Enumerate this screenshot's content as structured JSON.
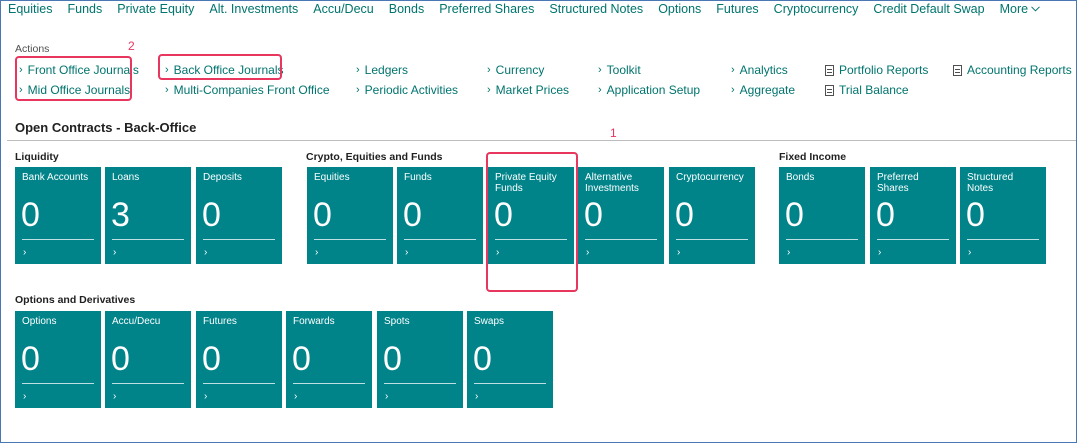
{
  "topnav": {
    "items": [
      "Equities",
      "Funds",
      "Private Equity",
      "Alt. Investments",
      "Accu/Decu",
      "Bonds",
      "Preferred Shares",
      "Structured Notes",
      "Options",
      "Futures",
      "Cryptocurrency",
      "Credit Default Swap"
    ],
    "more": "More"
  },
  "actions": {
    "label": "Actions",
    "front_office_journals": "Front Office Journals",
    "mid_office_journals": "Mid Office Journals",
    "back_office_journals": "Back Office Journals",
    "multi_companies_front_office": "Multi-Companies Front Office",
    "ledgers": "Ledgers",
    "periodic_activities": "Periodic Activities",
    "currency": "Currency",
    "market_prices": "Market Prices",
    "toolkit": "Toolkit",
    "application_setup": "Application Setup",
    "analytics": "Analytics",
    "aggregate": "Aggregate",
    "portfolio_reports": "Portfolio Reports",
    "trial_balance": "Trial Balance",
    "accounting_reports": "Accounting Reports"
  },
  "annotations": {
    "marker_1": "1",
    "marker_2": "2",
    "highlight_color": "#e8365f"
  },
  "page": {
    "title": "Open Contracts - Back-Office"
  },
  "groups": {
    "liquidity": {
      "title": "Liquidity",
      "tiles": [
        {
          "title": "Bank Accounts",
          "value": "0"
        },
        {
          "title": "Loans",
          "value": "3"
        },
        {
          "title": "Deposits",
          "value": "0"
        }
      ]
    },
    "crypto": {
      "title": "Crypto, Equities and Funds",
      "tiles": [
        {
          "title": "Equities",
          "value": "0"
        },
        {
          "title": "Funds",
          "value": "0"
        },
        {
          "title": "Private Equity Funds",
          "value": "0"
        },
        {
          "title": "Alternative Investments",
          "value": "0"
        },
        {
          "title": "Cryptocurrency",
          "value": "0"
        }
      ]
    },
    "fixed_income": {
      "title": "Fixed Income",
      "tiles": [
        {
          "title": "Bonds",
          "value": "0"
        },
        {
          "title": "Preferred Shares",
          "value": "0"
        },
        {
          "title": "Structured Notes",
          "value": "0"
        }
      ]
    },
    "options": {
      "title": "Options and Derivatives",
      "tiles": [
        {
          "title": "Options",
          "value": "0"
        },
        {
          "title": "Accu/Decu",
          "value": "0"
        },
        {
          "title": "Futures",
          "value": "0"
        },
        {
          "title": "Forwards",
          "value": "0"
        },
        {
          "title": "Spots",
          "value": "0"
        },
        {
          "title": "Swaps",
          "value": "0"
        }
      ]
    }
  },
  "colors": {
    "tile_bg": "#00848a",
    "link": "#00746e"
  }
}
